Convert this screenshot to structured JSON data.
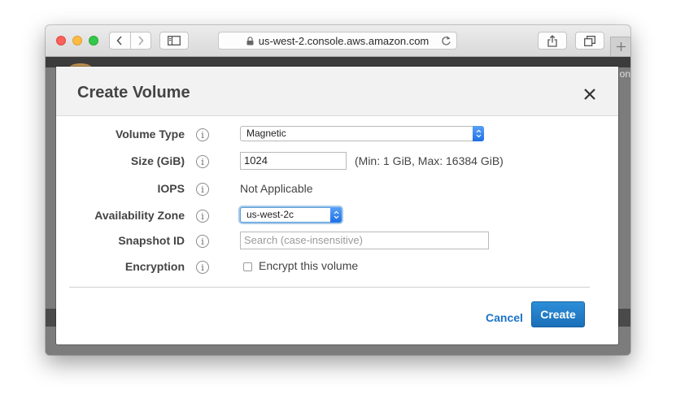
{
  "browser": {
    "url": "us-west-2.console.aws.amazon.com",
    "page_edge_text": "on"
  },
  "modal": {
    "title": "Create Volume",
    "fields": {
      "volume_type": {
        "label": "Volume Type",
        "value": "Magnetic"
      },
      "size": {
        "label": "Size (GiB)",
        "value": "1024",
        "hint": "(Min: 1 GiB, Max: 16384 GiB)"
      },
      "iops": {
        "label": "IOPS",
        "value": "Not Applicable"
      },
      "availability_zone": {
        "label": "Availability Zone",
        "value": "us-west-2c"
      },
      "snapshot_id": {
        "label": "Snapshot ID",
        "placeholder": "Search (case-insensitive)"
      },
      "encryption": {
        "label": "Encryption",
        "checkbox_label": "Encrypt this volume",
        "checked": false
      }
    },
    "info_glyph": "i",
    "cancel_label": "Cancel",
    "create_label": "Create"
  },
  "colors": {
    "primary_button": "#1a6fb8",
    "link": "#1a73c8",
    "select_spinner": "#1f6fe6"
  }
}
